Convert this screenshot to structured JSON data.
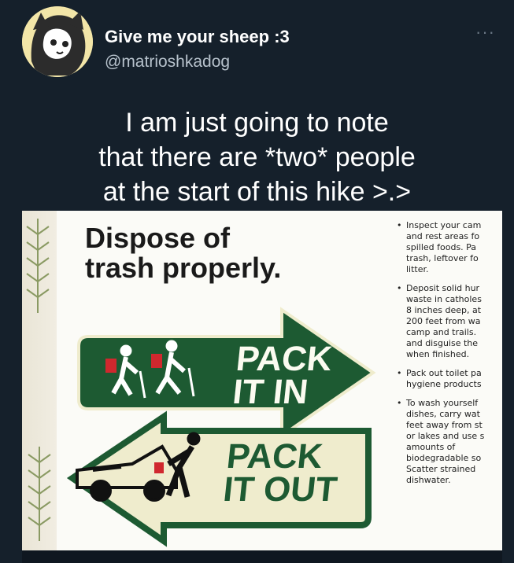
{
  "tweet": {
    "display_name": "Give me your sheep :3",
    "handle": "@matrioshkadog",
    "more_label": "···",
    "text_lines": [
      "I am just going to note",
      "that there are *two* people",
      "at the start of this hike >.>"
    ]
  },
  "media": {
    "sign_title_line1": "Dispose of",
    "sign_title_line2": "trash properly.",
    "pack_in_line1": "PACK",
    "pack_in_line2": "IT IN",
    "pack_out_line1": "PACK",
    "pack_out_line2": "IT OUT",
    "tips": [
      {
        "lines": [
          "Inspect your cam",
          "and rest areas fo",
          "spilled foods. Pa",
          "trash, leftover fo",
          "litter."
        ]
      },
      {
        "lines": [
          "Deposit solid hur",
          "waste in catholes",
          "8 inches deep, at",
          "200 feet from wa",
          "camp and trails.",
          "and disguise the",
          "when finished."
        ]
      },
      {
        "lines": [
          "Pack out toilet pa",
          "hygiene products"
        ]
      },
      {
        "lines": [
          "To wash yourself",
          "dishes, carry wat",
          "feet away from st",
          "or lakes and use s",
          "amounts of",
          "biodegradable so",
          "Scatter strained",
          "dishwater."
        ]
      }
    ]
  },
  "colors": {
    "background": "#15202b",
    "sign_green": "#1d5a32",
    "sign_cream": "#efeccd",
    "hiker_red": "#d0282e"
  }
}
